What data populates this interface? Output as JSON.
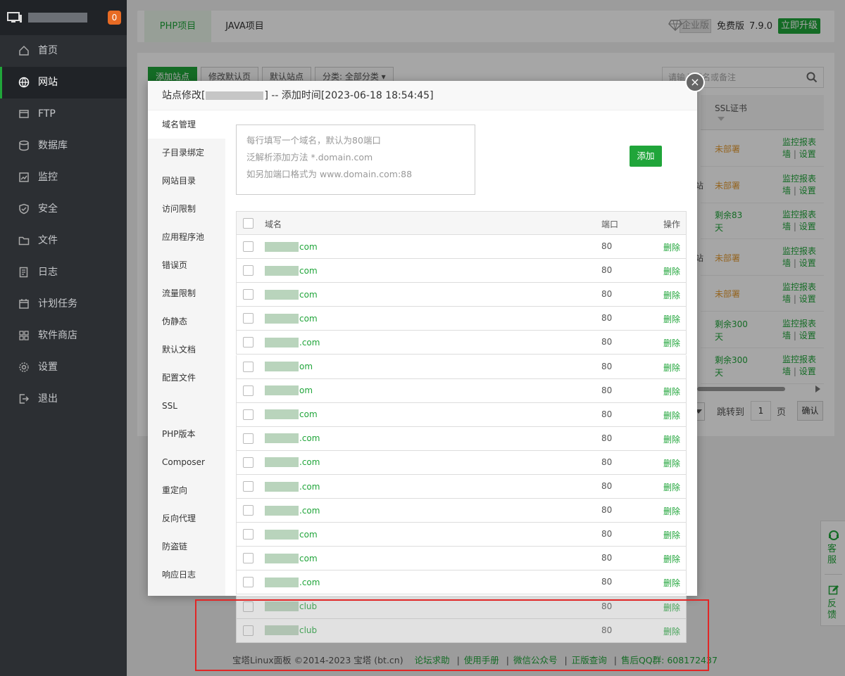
{
  "sidebar": {
    "badge": "0",
    "items": [
      {
        "label": "首页",
        "icon": "home-icon"
      },
      {
        "label": "网站",
        "icon": "globe-icon",
        "active": true
      },
      {
        "label": "FTP",
        "icon": "ftp-icon"
      },
      {
        "label": "数据库",
        "icon": "database-icon"
      },
      {
        "label": "监控",
        "icon": "monitor-icon"
      },
      {
        "label": "安全",
        "icon": "shield-icon"
      },
      {
        "label": "文件",
        "icon": "folder-icon"
      },
      {
        "label": "日志",
        "icon": "log-icon"
      },
      {
        "label": "计划任务",
        "icon": "calendar-icon"
      },
      {
        "label": "软件商店",
        "icon": "grid-icon"
      },
      {
        "label": "设置",
        "icon": "gear-icon"
      },
      {
        "label": "退出",
        "icon": "logout-icon"
      }
    ]
  },
  "topbar": {
    "tabs": [
      "PHP项目",
      "JAVA项目"
    ],
    "enterprise": "企业版",
    "free": "免费版",
    "version": "7.9.0",
    "upgrade": "立即升级"
  },
  "toolbar": {
    "add_site": "添加站点",
    "modify_default": "修改默认页",
    "default_site": "默认站点",
    "category": "分类: 全部分类",
    "search_placeholder": "请输入域名或备注"
  },
  "site_table": {
    "ssl_header": "SSL证书",
    "rows": [
      {
        "ssl": "未部署",
        "ssl_color": "#e39a31",
        "edge": ""
      },
      {
        "ssl": "未部署",
        "ssl_color": "#e39a31",
        "edge": "站"
      },
      {
        "ssl": "剩余83天",
        "ssl_color": "#20a53a",
        "edge": ""
      },
      {
        "ssl": "未部署",
        "ssl_color": "#e39a31",
        "edge": "站"
      },
      {
        "ssl": "未部署",
        "ssl_color": "#e39a31",
        "edge": ""
      },
      {
        "ssl": "剩余300天",
        "ssl_color": "#20a53a",
        "edge": ""
      },
      {
        "ssl": "剩余300天",
        "ssl_color": "#20a53a",
        "edge": ""
      }
    ],
    "action_monitor": "监控报表",
    "action_firewall": "墙",
    "action_settings": "设置",
    "jump_label": "跳转到",
    "page_no": "1",
    "page_unit": "页",
    "confirm": "确认"
  },
  "modal": {
    "title_prefix": "站点修改[",
    "title_suffix": "] -- 添加时间[2023-06-18 18:54:45]",
    "close": "×",
    "menu": [
      "域名管理",
      "子目录绑定",
      "网站目录",
      "访问限制",
      "应用程序池",
      "错误页",
      "流量限制",
      "伪静态",
      "默认文档",
      "配置文件",
      "SSL",
      "PHP版本",
      "Composer",
      "重定向",
      "反向代理",
      "防盗链",
      "响应日志"
    ],
    "textarea_lines": [
      "每行填写一个域名，默认为80端口",
      "泛解析添加方法 *.domain.com",
      "如另加端口格式为 www.domain.com:88"
    ],
    "add_button": "添加",
    "col_domain": "域名",
    "col_port": "端口",
    "col_action": "操作",
    "domains": [
      {
        "suffix": "com",
        "port": "80"
      },
      {
        "suffix": "com",
        "port": "80"
      },
      {
        "suffix": "com",
        "port": "80"
      },
      {
        "suffix": "com",
        "port": "80"
      },
      {
        "suffix": ".com",
        "port": "80"
      },
      {
        "suffix": "om",
        "port": "80"
      },
      {
        "suffix": "om",
        "port": "80"
      },
      {
        "suffix": "com",
        "port": "80"
      },
      {
        "suffix": ".com",
        "port": "80"
      },
      {
        "suffix": ".com",
        "port": "80"
      },
      {
        "suffix": ".com",
        "port": "80"
      },
      {
        "suffix": ".com",
        "port": "80"
      },
      {
        "suffix": "com",
        "port": "80"
      },
      {
        "suffix": "com",
        "port": "80"
      },
      {
        "suffix": ".com",
        "port": "80"
      }
    ],
    "overflow_domains": [
      {
        "suffix": "club",
        "port": "80"
      },
      {
        "suffix": "club",
        "port": "80"
      }
    ],
    "delete": "删除"
  },
  "footer": {
    "prefix": "宝塔Linux面板 ©2014-2023 宝塔 (bt.cn)",
    "links": [
      "论坛求助",
      "使用手册",
      "微信公众号",
      "正版查询"
    ],
    "qq": "售后QQ群: 608172437"
  },
  "side_service": {
    "service": "客服",
    "feedback": "反馈"
  },
  "colors": {
    "accent": "#20a53a",
    "warning": "#e39a31",
    "highlight_box": "#e12626"
  }
}
